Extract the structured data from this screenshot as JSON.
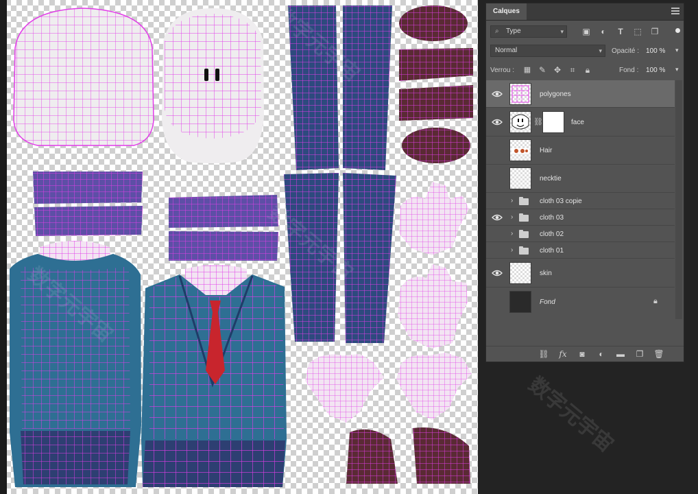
{
  "panel": {
    "tab_label": "Calques",
    "filter_type": "Type",
    "blend_mode": "Normal",
    "opacity_label": "Opacité :",
    "opacity_value": "100 %",
    "lock_label": "Verrou :",
    "fill_label": "Fond :",
    "fill_value": "100 %"
  },
  "layers": [
    {
      "name": "polygones",
      "visible": true,
      "selected": true,
      "kind": "layer"
    },
    {
      "name": "face",
      "visible": true,
      "selected": false,
      "kind": "layer-mask"
    },
    {
      "name": "Hair",
      "visible": false,
      "selected": false,
      "kind": "layer"
    },
    {
      "name": "necktie",
      "visible": false,
      "selected": false,
      "kind": "layer"
    },
    {
      "name": "cloth 03 copie",
      "visible": false,
      "selected": false,
      "kind": "group"
    },
    {
      "name": "cloth 03",
      "visible": true,
      "selected": false,
      "kind": "group"
    },
    {
      "name": "cloth 02",
      "visible": false,
      "selected": false,
      "kind": "group"
    },
    {
      "name": "cloth 01",
      "visible": false,
      "selected": false,
      "kind": "group"
    },
    {
      "name": "skin",
      "visible": true,
      "selected": false,
      "kind": "layer"
    },
    {
      "name": "Fond",
      "visible": false,
      "selected": false,
      "kind": "background",
      "locked": true
    }
  ],
  "colors": {
    "wire": "#e23ce8",
    "cloth_blue": "#2d4a7e",
    "cloth_teal": "#2e6f93",
    "skin": "#f0eef0",
    "dark_maroon": "#5a2a34",
    "tie_red": "#c8252d",
    "panel_bg": "#535353"
  },
  "footer_icons": [
    "link-icon",
    "fx-icon",
    "mask-icon",
    "adjustment-icon",
    "folder-icon",
    "new-layer-icon",
    "trash-icon"
  ],
  "watermark": "数字元宇宙"
}
